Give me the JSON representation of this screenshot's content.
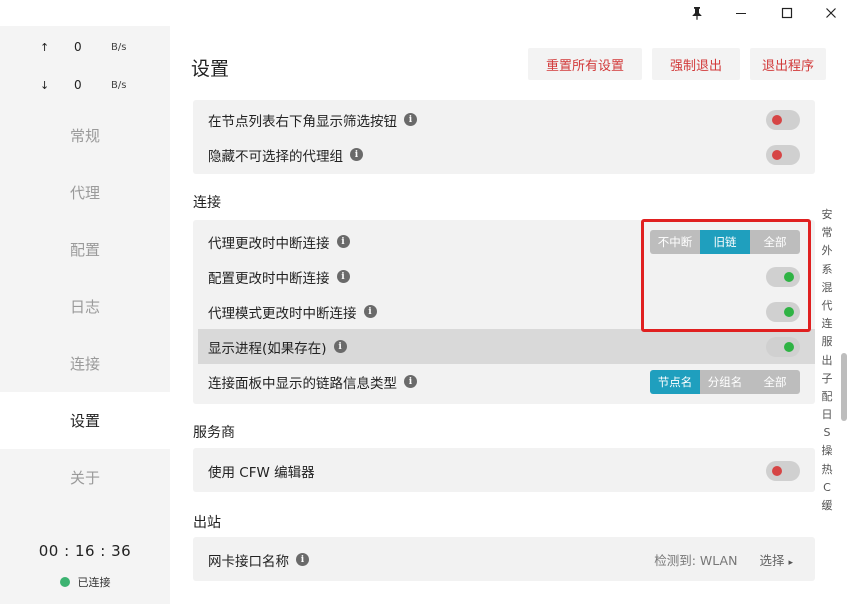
{
  "titlebar": {
    "pin_icon": "📌",
    "min_icon": "—",
    "max_icon": "☐",
    "close_icon": "✕"
  },
  "sidebar": {
    "upload": {
      "arrow": "↑",
      "value": "0",
      "unit": "B/s"
    },
    "download": {
      "arrow": "↓",
      "value": "0",
      "unit": "B/s"
    },
    "items": [
      {
        "label": "常规",
        "active": false
      },
      {
        "label": "代理",
        "active": false
      },
      {
        "label": "配置",
        "active": false
      },
      {
        "label": "日志",
        "active": false
      },
      {
        "label": "连接",
        "active": false
      },
      {
        "label": "设置",
        "active": true
      },
      {
        "label": "关于",
        "active": false
      }
    ],
    "clock": "00 : 16 : 36",
    "status": "已连接",
    "status_color": "#3cb371"
  },
  "header": {
    "title": "设置",
    "reset_label": "重置所有设置",
    "force_quit_label": "强制退出",
    "exit_label": "退出程序"
  },
  "card_top": {
    "rows": [
      {
        "label": "在节点列表右下角显示筛选按钮",
        "toggle": "off"
      },
      {
        "label": "隐藏不可选择的代理组",
        "toggle": "off"
      }
    ]
  },
  "connection": {
    "title": "连接",
    "row1": {
      "label": "代理更改时中断连接",
      "options": [
        "不中断",
        "旧链",
        "全部"
      ],
      "selected": "旧链"
    },
    "row2": {
      "label": "配置更改时中断连接",
      "toggle": "on"
    },
    "row3": {
      "label": "代理模式更改时中断连接",
      "toggle": "on"
    },
    "row4": {
      "label": "显示进程(如果存在)",
      "toggle": "on"
    },
    "row5": {
      "label": "连接面板中显示的链路信息类型",
      "options": [
        "节点名",
        "分组名",
        "全部"
      ],
      "selected": "节点名"
    }
  },
  "provider": {
    "title": "服务商",
    "row1": {
      "label": "使用 CFW 编辑器",
      "toggle": "off"
    }
  },
  "outbound": {
    "title": "出站",
    "row1": {
      "label": "网卡接口名称",
      "detected": "检测到: WLAN",
      "select_label": "选择",
      "select_icon": "▸"
    }
  },
  "side_index": [
    "安",
    "常",
    "外",
    "系",
    "混",
    "代",
    "连",
    "服",
    "出",
    "子",
    "配",
    "日",
    "S",
    "操",
    "热",
    "C",
    "缓"
  ],
  "colors": {
    "accent": "#1f9fbe",
    "danger": "#d23a3a",
    "toggle_on": "#2fb344",
    "toggle_off": "#d64545",
    "highlight_box": "#e02020"
  }
}
